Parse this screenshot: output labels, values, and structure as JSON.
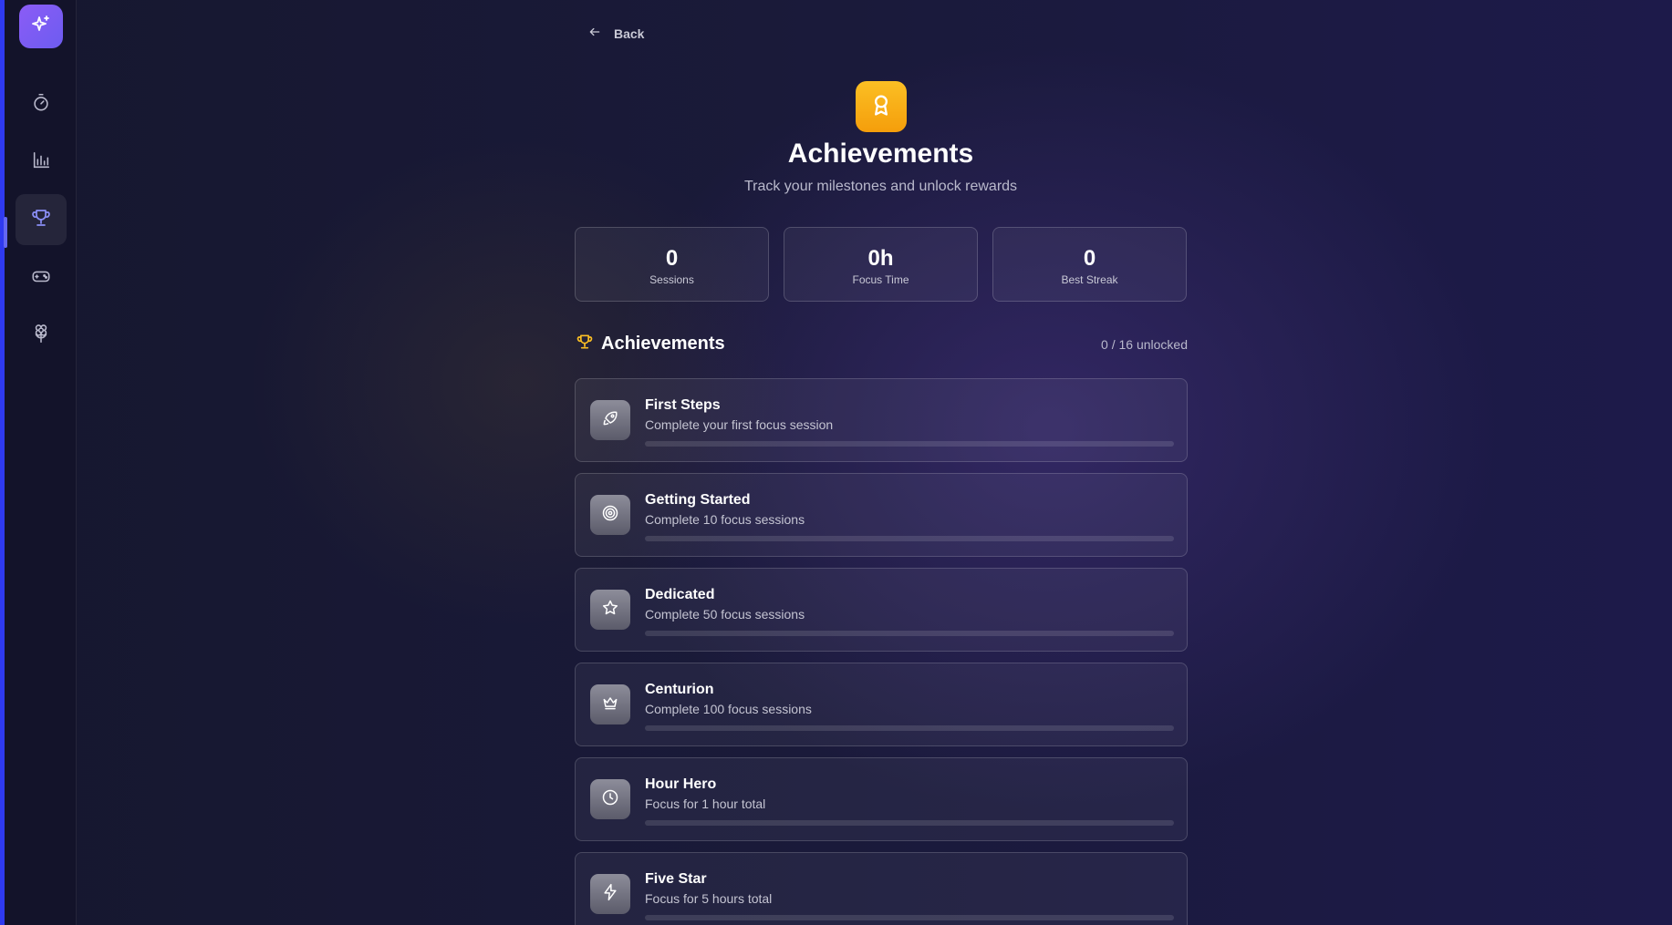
{
  "colors": {
    "accent": "#6366f1",
    "logo": "#8b5cf6",
    "trophy": "#fbbf24",
    "locked_icon": "#7a7a88"
  },
  "sidebar": {
    "logo_icon": "sparkles-icon",
    "items": [
      {
        "name": "timer",
        "icon": "stopwatch-icon",
        "active": false
      },
      {
        "name": "stats",
        "icon": "bar-chart-icon",
        "active": false
      },
      {
        "name": "achievements",
        "icon": "trophy-icon",
        "active": true
      },
      {
        "name": "games",
        "icon": "gamepad-icon",
        "active": false
      },
      {
        "name": "garden",
        "icon": "flower-icon",
        "active": false
      }
    ]
  },
  "header": {
    "back_label": "Back",
    "title": "Achievements",
    "subtitle": "Track your milestones and unlock rewards"
  },
  "stats": [
    {
      "value": "0",
      "label": "Sessions"
    },
    {
      "value": "0h",
      "label": "Focus Time"
    },
    {
      "value": "0",
      "label": "Best Streak"
    }
  ],
  "achievements_section": {
    "title": "Achievements",
    "count": "0 / 16 unlocked"
  },
  "achievements": [
    {
      "name": "First Steps",
      "description": "Complete your first focus session",
      "icon": "rocket-icon",
      "progress": 0
    },
    {
      "name": "Getting Started",
      "description": "Complete 10 focus sessions",
      "icon": "target-icon",
      "progress": 0
    },
    {
      "name": "Dedicated",
      "description": "Complete 50 focus sessions",
      "icon": "star-icon",
      "progress": 0
    },
    {
      "name": "Centurion",
      "description": "Complete 100 focus sessions",
      "icon": "crown-icon",
      "progress": 0
    },
    {
      "name": "Hour Hero",
      "description": "Focus for 1 hour total",
      "icon": "clock-icon",
      "progress": 0
    },
    {
      "name": "Five Star",
      "description": "Focus for 5 hours total",
      "icon": "lightning-icon",
      "progress": 0
    }
  ]
}
